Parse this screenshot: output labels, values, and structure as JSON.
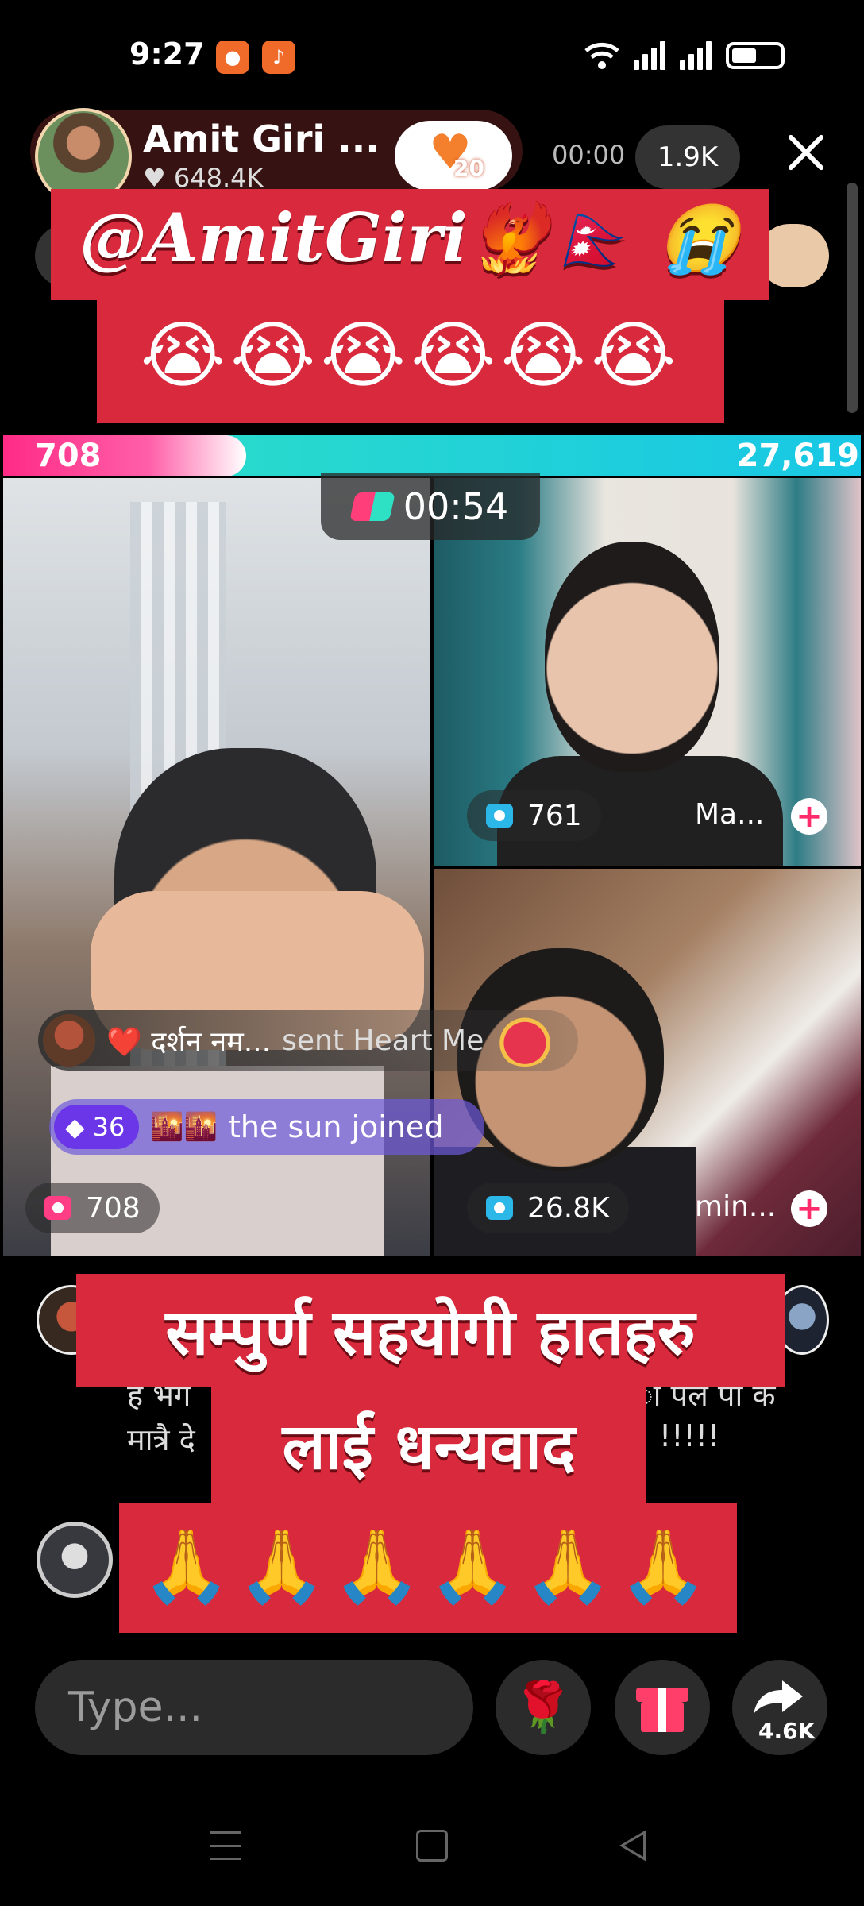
{
  "status_bar": {
    "time": "9:27",
    "icons": [
      "record-icon",
      "app-icon",
      "wifi-icon",
      "signal-icon",
      "signal-icon",
      "battery-icon"
    ]
  },
  "host": {
    "name": "Amit Giri ...",
    "likes": "648.4K",
    "like_badge_count": "20",
    "timer": "00:00",
    "viewers": "1.9K"
  },
  "overlay_top": {
    "handle": "@AmitGiri🐦‍🔥🇳🇵 😭",
    "emojis": "😭😭😭😭😭😭"
  },
  "battle": {
    "left_score": "708",
    "right_score": "27,619",
    "timer": "00:54",
    "colors": {
      "left": "#ff2b86",
      "right": "#18c7e5"
    }
  },
  "tiles": {
    "host_stat": "708",
    "guest1_stat": "761",
    "guest1_name": "Ma...",
    "guest2_stat": "26.8K",
    "guest2_name": "min..."
  },
  "notifications": {
    "gift_sender": "❤️ दर्शन नम...",
    "gift_text": "sent Heart Me",
    "join_badge": "36",
    "join_flames": "🌇🌇",
    "join_text": "the sun joined"
  },
  "comments": {
    "line1": "ह भग",
    "line1_end": "ा पल पा क",
    "line2": "मात्रै दे",
    "line2_end": "!!!!!"
  },
  "overlay_bottom": {
    "line1": "सम्पुर्ण सहयोगी हातहरु",
    "line2": "लाई धन्यवाद",
    "emojis": "🙏🙏🙏🙏🙏🙏"
  },
  "input_bar": {
    "placeholder": "Type...",
    "rose": "🌹",
    "share_count": "4.6K"
  },
  "colors": {
    "banner_red": "#d82a3c",
    "accent_pink": "#ff2b6b"
  }
}
